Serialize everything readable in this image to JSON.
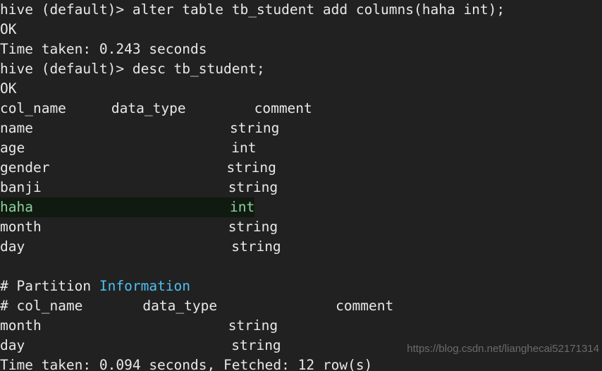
{
  "terminal": {
    "background_color": "#212121",
    "foreground_color": "#e8e8e8",
    "accent_cyan": "#4ec0f0",
    "accent_green": "#8fd19e",
    "highlight_background": "#101a10",
    "prompt": "hive (default)> ",
    "lines": [
      {
        "id": "cmd-alter",
        "text": "hive (default)> alter table tb_student add columns(haha int);"
      },
      {
        "id": "status-ok-1",
        "text": "OK"
      },
      {
        "id": "time-taken-1",
        "text": "Time taken: 0.243 seconds"
      },
      {
        "id": "cmd-desc",
        "text": "hive (default)> desc tb_student;"
      },
      {
        "id": "status-ok-2",
        "text": "OK"
      },
      {
        "id": "schema-header",
        "text": "col_name            \tdata_type           \tcomment"
      },
      {
        "id": "row-name",
        "text": "name                    \tstring"
      },
      {
        "id": "row-age",
        "text": "age                     \tint"
      },
      {
        "id": "row-gender",
        "text": "gender                  \tstring"
      },
      {
        "id": "row-banji",
        "text": "banji                   \tstring"
      },
      {
        "id": "row-haha",
        "text": "haha                    \tint"
      },
      {
        "id": "row-month",
        "text": "month                   \tstring"
      },
      {
        "id": "row-day",
        "text": "day                     \tstring"
      },
      {
        "id": "blank",
        "text": ""
      },
      {
        "id": "partition-title",
        "text": "# Partition Information"
      },
      {
        "id": "partition-header",
        "text": "# col_name              \tdata_type               \tcomment"
      },
      {
        "id": "part-row-month",
        "text": "month                   \tstring"
      },
      {
        "id": "part-row-day",
        "text": "day                     \tstring"
      },
      {
        "id": "time-taken-2",
        "text": "Time taken: 0.094 seconds, Fetched: 12 row(s)"
      }
    ],
    "commands": {
      "alter_prefix": "hive (default)> ",
      "alter_statement": "alter table tb_student add columns(haha int);",
      "desc_prefix": "hive (default)> ",
      "desc_statement": "desc tb_student;"
    },
    "status": {
      "ok_1": "OK",
      "ok_2": "OK",
      "time_taken_1": "Time taken: 0.243 seconds",
      "time_taken_2": "Time taken: 0.094 seconds, Fetched: 12 row(s)"
    },
    "schema_table": {
      "headers": {
        "col_name": "col_name",
        "data_type": "data_type",
        "comment": "comment"
      },
      "rows": [
        {
          "col_name": "name",
          "data_type": "string",
          "comment": "",
          "highlighted": false
        },
        {
          "col_name": "age",
          "data_type": "int",
          "comment": "",
          "highlighted": false
        },
        {
          "col_name": "gender",
          "data_type": "string",
          "comment": "",
          "highlighted": false
        },
        {
          "col_name": "banji",
          "data_type": "string",
          "comment": "",
          "highlighted": false
        },
        {
          "col_name": "haha",
          "data_type": "int",
          "comment": "",
          "highlighted": true
        },
        {
          "col_name": "month",
          "data_type": "string",
          "comment": "",
          "highlighted": false
        },
        {
          "col_name": "day",
          "data_type": "string",
          "comment": "",
          "highlighted": false
        }
      ]
    },
    "partition_section": {
      "title_hash": "# ",
      "title_word_1": "Partition ",
      "title_word_2": "Information",
      "headers": {
        "col_name": "# col_name",
        "data_type": "data_type",
        "comment": "comment"
      },
      "rows": [
        {
          "col_name": "month",
          "data_type": "string",
          "comment": ""
        },
        {
          "col_name": "day",
          "data_type": "string",
          "comment": ""
        }
      ]
    }
  },
  "watermark": {
    "text": "https://blog.csdn.net/lianghecai52171314"
  }
}
